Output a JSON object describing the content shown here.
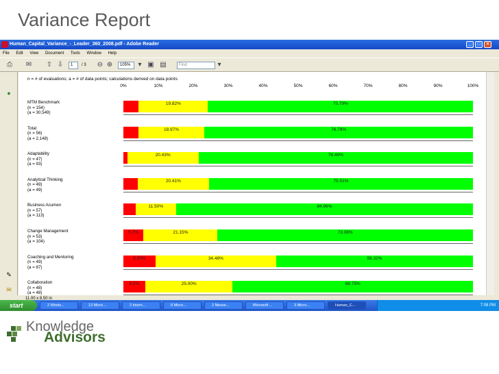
{
  "slide": {
    "title": "Variance Report"
  },
  "window": {
    "title": "Human_Capital_Variance_-_Leader_360_2008.pdf - Adobe Reader"
  },
  "menu": [
    "File",
    "Edit",
    "View",
    "Document",
    "Tools",
    "Window",
    "Help"
  ],
  "toolbar": {
    "page": "1",
    "page_total": "/ 3",
    "zoom": "105%",
    "find_placeholder": "Find"
  },
  "doc": {
    "header": "n = # of evaluations; a = # of data points; calculations derived on data points",
    "pct_ticks": [
      "0%",
      "10%",
      "20%",
      "30%",
      "40%",
      "50%",
      "60%",
      "70%",
      "80%",
      "90%",
      "100%"
    ]
  },
  "chart_data": {
    "type": "bar",
    "stacked": true,
    "xlim": [
      0,
      100
    ],
    "categories": [
      {
        "name": "MTM Benchmark",
        "n": "(n = 154)",
        "a": "(a = 30,549)"
      },
      {
        "name": "Total",
        "n": "(n = 56)",
        "a": "(a = 2,148)"
      },
      {
        "name": "Adaptability",
        "n": "(n = 47)",
        "a": "(a = 93)"
      },
      {
        "name": "Analytical Thinking",
        "n": "(n = 49)",
        "a": "(a = 49)"
      },
      {
        "name": "Business Acumen",
        "n": "(n = 57)",
        "a": "(a = 113)"
      },
      {
        "name": "Change Management",
        "n": "(n = 53)",
        "a": "(a = 104)"
      },
      {
        "name": "Coaching and Mentoring",
        "n": "(n = 49)",
        "a": "(a = 87)"
      },
      {
        "name": "Collaboration",
        "n": "(n = 48)",
        "a": "(a = 48)"
      }
    ],
    "series": [
      {
        "color": "#ff0000",
        "values": [
          4.39,
          4.24,
          1.08,
          4.08,
          3.54,
          5.77,
          9.2,
          6.25
        ],
        "labels": [
          "",
          "",
          "",
          "",
          "",
          "5.7%",
          "9.20%",
          "6.2%"
        ]
      },
      {
        "color": "#ffff00",
        "values": [
          19.82,
          18.97,
          20.43,
          20.41,
          11.5,
          21.15,
          34.48,
          25.0
        ],
        "labels": [
          "19.82%",
          "18.97%",
          "20.43%",
          "20.41%",
          "11.50%",
          "21.15%",
          "34.48%",
          "25.00%"
        ]
      },
      {
        "color": "#00ff00",
        "values": [
          75.79,
          76.79,
          78.49,
          75.51,
          84.96,
          73.08,
          56.32,
          68.75
        ],
        "labels": [
          "75.79%",
          "76.79%",
          "78.49%",
          "75.51%",
          "84.96%",
          "73.08%",
          "56.32%",
          "68.75%"
        ]
      }
    ]
  },
  "statusbar": {
    "page_size": "11.00 x 8.50 in"
  },
  "taskbar": {
    "start": "start",
    "items": [
      "2 Windo...",
      "13 Micro...",
      "2 Intern...",
      "8 Micro...",
      "2 Messe...",
      "Microsoft ...",
      "3 Micro...",
      "Human_C..."
    ],
    "time": "7:08 PM"
  },
  "logo": {
    "line1": "Knowledge",
    "line2": "Advisors"
  },
  "colors": {
    "red": "#ff0000",
    "yellow": "#ffff00",
    "green": "#00ff00",
    "brand_green": "#3f6e2f"
  }
}
